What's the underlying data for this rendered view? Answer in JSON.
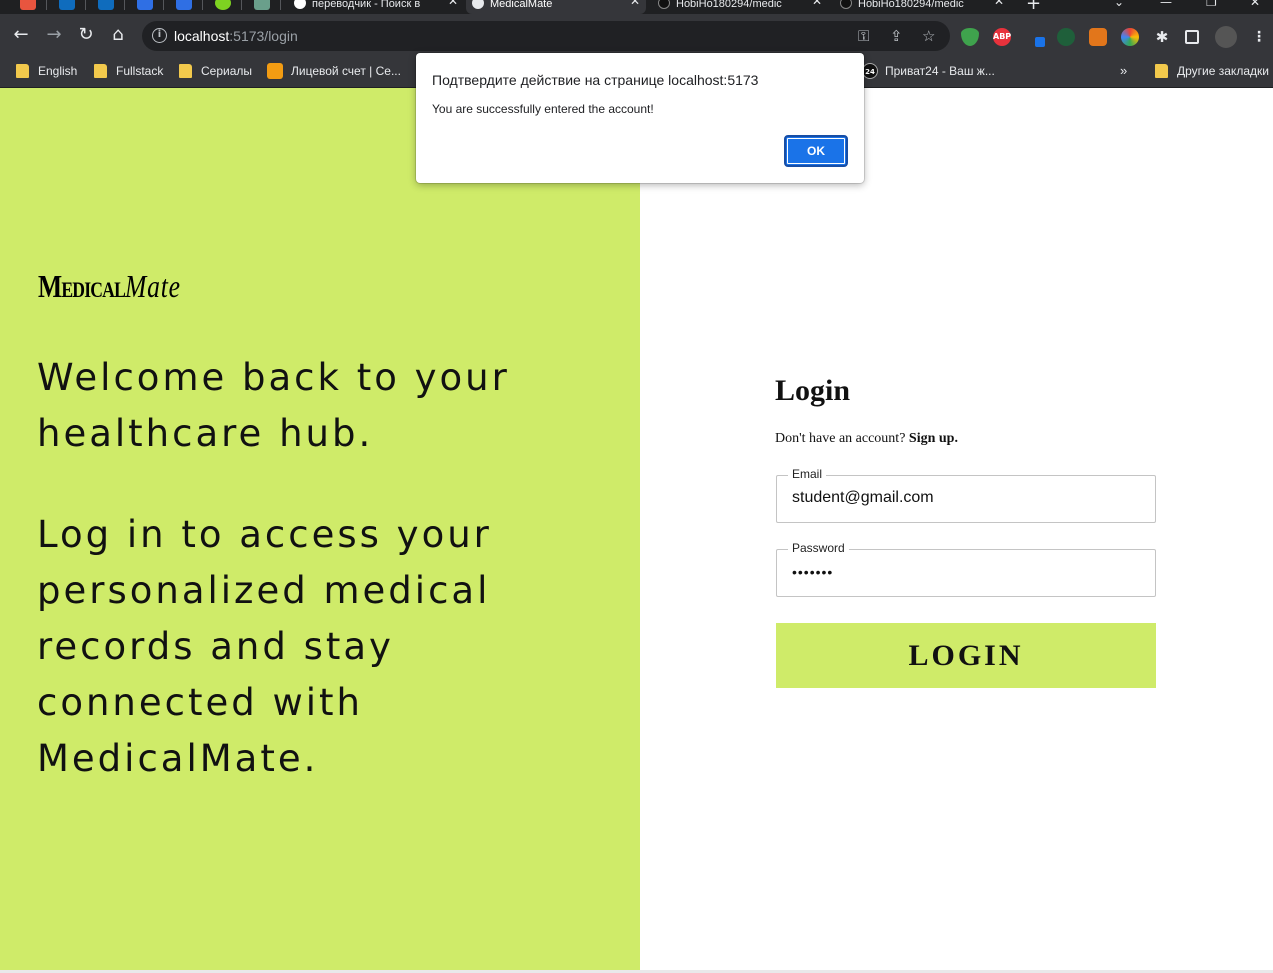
{
  "browser": {
    "tabs": [
      {
        "title": "переводчик - Поиск в",
        "icon": "google-icon"
      },
      {
        "title": "MedicalMate",
        "icon": "globe-icon"
      },
      {
        "title": "HobiHo180294/medic",
        "icon": "github-icon"
      },
      {
        "title": "HobiHo180294/medic",
        "icon": "github-icon"
      }
    ],
    "url": {
      "host": "localhost",
      "path": ":5173/login"
    },
    "bookmarks": [
      {
        "label": "English",
        "icon": "folder-icon"
      },
      {
        "label": "Fullstack",
        "icon": "folder-icon"
      },
      {
        "label": "Сериалы",
        "icon": "folder-icon"
      },
      {
        "label": "Лицевой счет | Се...",
        "icon": "site-icon"
      },
      {
        "label": "Приват24 - Ваш ж...",
        "icon": "privat24-icon",
        "badge": "24"
      },
      {
        "label": "Другие закладки",
        "icon": "folder-icon"
      }
    ],
    "bookmarks_overflow": "»",
    "extensions": {
      "abp": "ABP"
    }
  },
  "dialog": {
    "title": "Подтвердите действие на странице localhost:5173",
    "message": "You are successfully entered the account!",
    "ok_label": "OK"
  },
  "hero": {
    "logo_medical": "Medical",
    "logo_mate": "Mate",
    "tagline_1": "Welcome back to your healthcare hub.",
    "tagline_2": "Log in to access your personalized medical records and stay connected with MedicalMate."
  },
  "login": {
    "title": "Login",
    "signup_prompt": "Don't have an account?",
    "signup_link": "Sign up.",
    "email_label": "Email",
    "email_value": "student@gmail.com",
    "password_label": "Password",
    "password_value": "•••••••",
    "button_label": "LOGIN"
  },
  "colors": {
    "accent": "#cfeb69",
    "dialog_button": "#1a73e8"
  }
}
